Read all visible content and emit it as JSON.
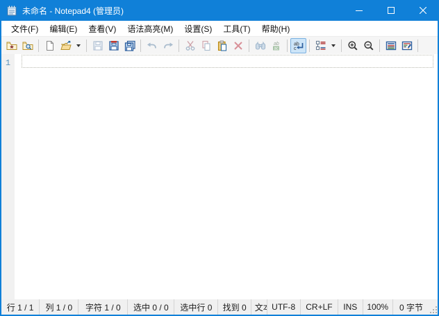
{
  "window": {
    "title": "未命名 - Notepad4 (管理员)",
    "accent_color": "#1080d8",
    "is_admin": true
  },
  "titlebar": {
    "icons": [
      "notepad-app-icon",
      "minimize-icon",
      "maximize-icon",
      "close-icon"
    ]
  },
  "menu": {
    "items": [
      {
        "label": "文件(F)"
      },
      {
        "label": "编辑(E)"
      },
      {
        "label": "查看(V)"
      },
      {
        "label": "语法高亮(M)"
      },
      {
        "label": "设置(S)"
      },
      {
        "label": "工具(T)"
      },
      {
        "label": "帮助(H)"
      }
    ]
  },
  "toolbar": {
    "buttons": [
      {
        "icon": "favorites-folder-icon",
        "state": "enabled"
      },
      {
        "icon": "browse-folder-icon",
        "state": "enabled"
      },
      {
        "icon": "new-file-icon",
        "state": "enabled"
      },
      {
        "icon": "open-file-icon",
        "state": "enabled",
        "has_dropdown": true
      },
      {
        "icon": "save-icon",
        "state": "disabled"
      },
      {
        "icon": "save-as-icon",
        "state": "enabled"
      },
      {
        "icon": "save-copy-icon",
        "state": "enabled"
      },
      {
        "icon": "undo-icon",
        "state": "disabled"
      },
      {
        "icon": "redo-icon",
        "state": "disabled"
      },
      {
        "icon": "cut-icon",
        "state": "disabled"
      },
      {
        "icon": "copy-icon",
        "state": "disabled"
      },
      {
        "icon": "paste-icon",
        "state": "enabled"
      },
      {
        "icon": "delete-icon",
        "state": "disabled"
      },
      {
        "icon": "find-icon",
        "state": "disabled"
      },
      {
        "icon": "replace-icon",
        "state": "disabled"
      },
      {
        "icon": "word-wrap-icon",
        "state": "pressed"
      },
      {
        "icon": "scheme-icon",
        "state": "enabled",
        "has_dropdown": true
      },
      {
        "icon": "zoom-in-icon",
        "state": "enabled"
      },
      {
        "icon": "zoom-out-icon",
        "state": "enabled"
      },
      {
        "icon": "view-styles-icon",
        "state": "enabled"
      },
      {
        "icon": "customize-styles-icon",
        "state": "enabled"
      }
    ]
  },
  "editor": {
    "line_numbers": [
      "1"
    ],
    "content": "",
    "current_line": 1
  },
  "statusbar": {
    "segments": [
      {
        "name": "line",
        "label": "行 1 / 1"
      },
      {
        "name": "column",
        "label": "列 1 / 0"
      },
      {
        "name": "character",
        "label": "字符 1 / 0"
      },
      {
        "name": "selection",
        "label": "选中 0 / 0"
      },
      {
        "name": "selected-lines",
        "label": "选中行 0"
      },
      {
        "name": "found",
        "label": "找到 0"
      },
      {
        "name": "scheme",
        "label": "文本"
      },
      {
        "name": "encoding",
        "label": "UTF-8"
      },
      {
        "name": "eol",
        "label": "CR+LF"
      },
      {
        "name": "insert-mode",
        "label": "INS"
      },
      {
        "name": "zoom",
        "label": "100%"
      },
      {
        "name": "size",
        "label": "0 字节"
      }
    ]
  }
}
